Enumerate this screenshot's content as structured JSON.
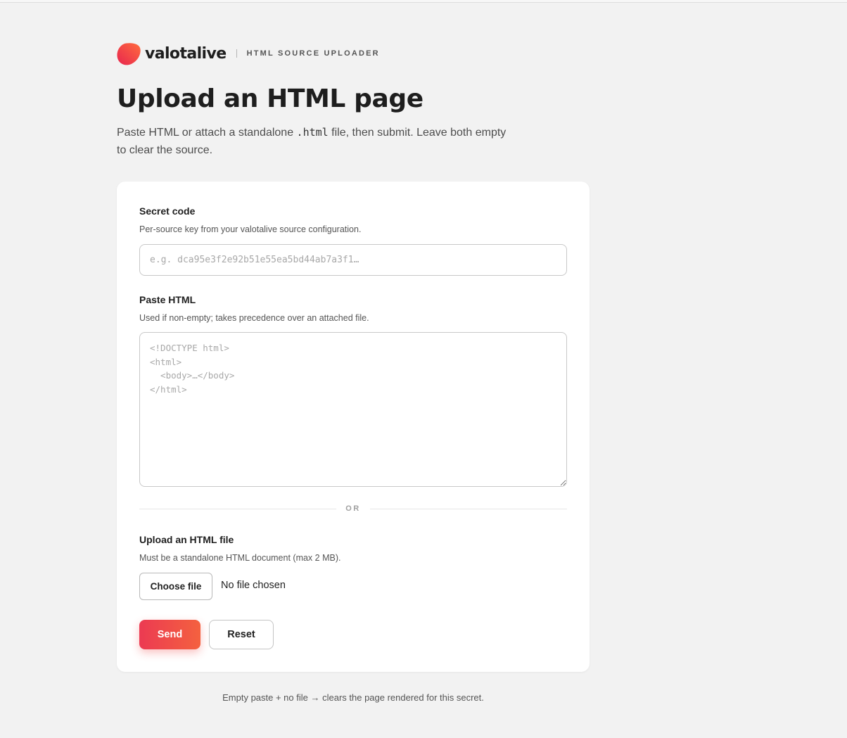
{
  "brand": {
    "wordmark": "valotalive",
    "tagline": "HTML SOURCE UPLOADER",
    "accent_start": "#ff6b3d",
    "accent_end": "#e8264f",
    "logo_icon": "valotalive-logo-icon"
  },
  "page": {
    "title": "Upload an HTML page",
    "intro_before": "Paste HTML or attach a standalone ",
    "intro_code": ".html",
    "intro_after": " file, then submit. Leave both empty to clear the source."
  },
  "form": {
    "secret": {
      "label": "Secret code",
      "help": "Per-source key from your valotalive source configuration.",
      "value": "",
      "placeholder": "e.g. dca95e3f2e92b51e55ea5bd44ab7a3f1…"
    },
    "paste": {
      "label": "Paste HTML",
      "help": "Used if non-empty; takes precedence over an attached file.",
      "value": "",
      "placeholder": "<!DOCTYPE html>\n<html>\n  <body>…</body>\n</html>"
    },
    "divider_text": "OR",
    "file": {
      "label": "Upload an HTML file",
      "help": "Must be a standalone HTML document (max 2 MB).",
      "button_label": "Choose file",
      "status": "No file chosen"
    },
    "send_label": "Send",
    "reset_label": "Reset"
  },
  "footnote": "Empty paste + no file → clears the page rendered for this secret."
}
